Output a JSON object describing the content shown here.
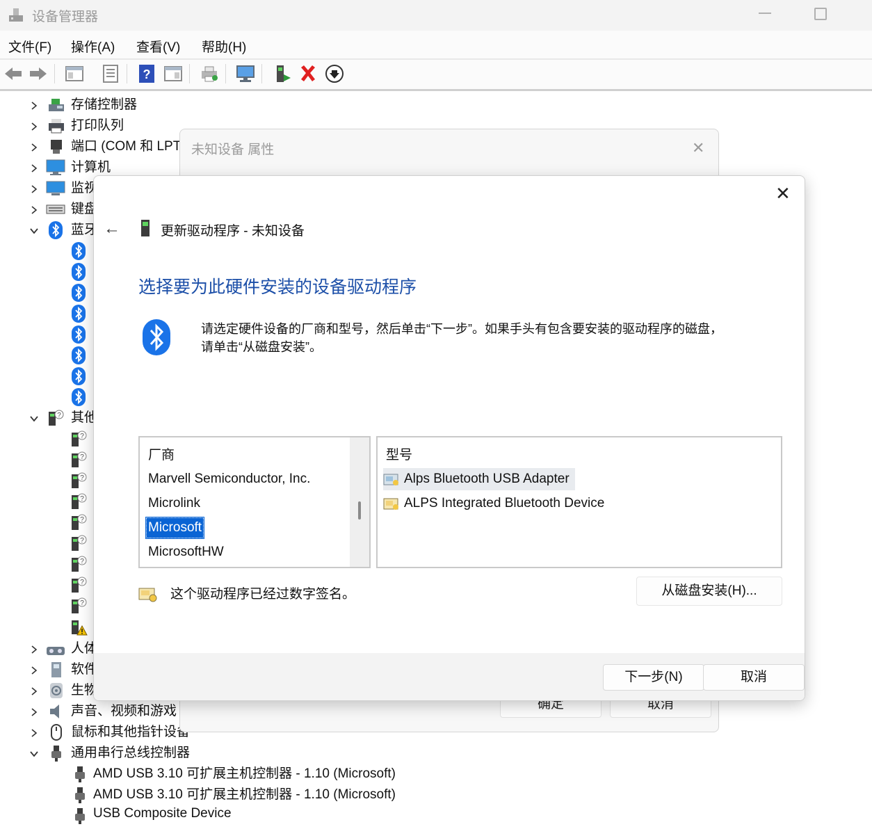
{
  "window": {
    "title": "设备管理器"
  },
  "menu": [
    {
      "label": "文件(F)"
    },
    {
      "label": "操作(A)"
    },
    {
      "label": "查看(V)"
    },
    {
      "label": "帮助(H)"
    }
  ],
  "tree": {
    "categories": [
      {
        "label": "存储控制器",
        "icon": "storage-controller-icon"
      },
      {
        "label": "打印队列",
        "icon": "printer-icon"
      },
      {
        "label": "端口 (COM 和 LPT",
        "icon": "port-icon"
      },
      {
        "label": "计算机",
        "icon": "computer-icon"
      },
      {
        "label": "监视",
        "icon": "monitor-icon"
      },
      {
        "label": "键盘",
        "icon": "keyboard-icon"
      },
      {
        "label": "蓝牙",
        "icon": "bluetooth-icon"
      },
      {
        "label": "其他",
        "icon": "unknown-device-icon"
      },
      {
        "label": "人体",
        "icon": "hid-icon"
      },
      {
        "label": "软件",
        "icon": "software-device-icon"
      },
      {
        "label": "生物",
        "icon": "biometric-icon"
      },
      {
        "label": "声音、视频和游戏",
        "icon": "sound-icon"
      },
      {
        "label": "鼠标和其他指针设备",
        "icon": "mouse-icon"
      },
      {
        "label": "通用串行总线控制器",
        "icon": "usb-icon"
      }
    ],
    "usb_children": [
      {
        "label": "AMD USB 3.10 可扩展主机控制器 - 1.10 (Microsoft)"
      },
      {
        "label": "AMD USB 3.10 可扩展主机控制器 - 1.10 (Microsoft)"
      },
      {
        "label": "USB Composite Device"
      }
    ]
  },
  "properties_dialog": {
    "title": "未知设备 属性",
    "ok_label": "确定",
    "cancel_label": "取消"
  },
  "wizard": {
    "header": "更新驱动程序 - 未知设备",
    "heading": "选择要为此硬件安装的设备驱动程序",
    "instruction_line1": "请选定硬件设备的厂商和型号，然后单击“下一步”。如果手头有包含要安装的驱动程序的磁盘，",
    "instruction_line2": "请单击“从磁盘安装”。",
    "manufacturer_header": "厂商",
    "manufacturers": [
      {
        "label": "Marvell Semiconductor, Inc."
      },
      {
        "label": "Microlink"
      },
      {
        "label": "Microsoft"
      },
      {
        "label": "MicrosoftHW"
      }
    ],
    "selected_manufacturer": "Microsoft",
    "model_header": "型号",
    "models": [
      {
        "label": "Alps Bluetooth USB Adapter"
      },
      {
        "label": "ALPS Integrated Bluetooth Device"
      }
    ],
    "signed_text": "这个驱动程序已经过数字签名。",
    "have_disk_label": "从磁盘安装(H)...",
    "next_label": "下一步(N)",
    "cancel_label": "取消"
  },
  "colors": {
    "accent": "#0a64d4",
    "heading": "#1c4fa8",
    "bluetooth": "#1a73e8",
    "delete_red": "#e02020"
  }
}
